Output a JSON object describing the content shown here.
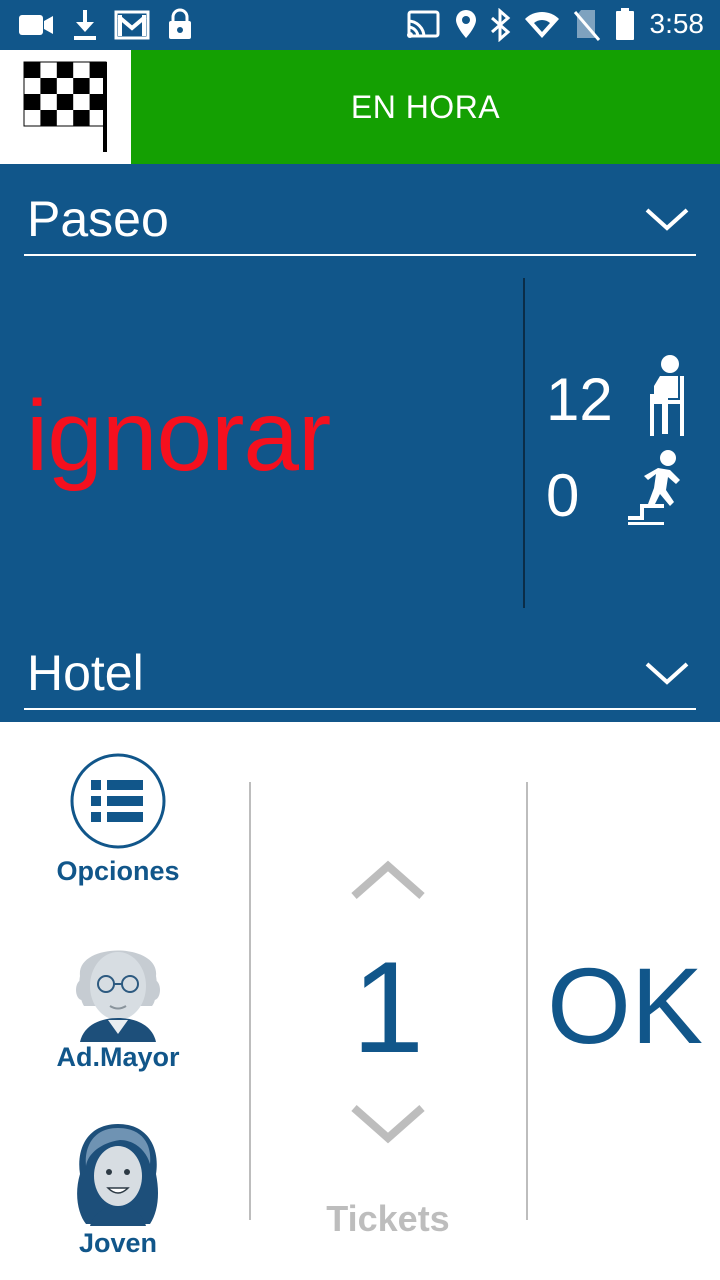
{
  "status_bar": {
    "time": "3:58",
    "icons": [
      "video-camera-icon",
      "download-icon",
      "gmail-icon",
      "lock-icon",
      "cast-icon",
      "location-pin-icon",
      "bluetooth-icon",
      "wifi-icon",
      "no-sim-icon",
      "battery-icon"
    ]
  },
  "header": {
    "status_label": "EN HORA",
    "status_color": "#14a002",
    "flag_icon": "checkered-flag-icon"
  },
  "trip": {
    "origin": "Paseo",
    "destination": "Hotel",
    "message": "ignorar",
    "message_color": "#f5101e",
    "seated_count": "12",
    "standing_count": "0",
    "panel_color": "#11568a"
  },
  "ticket_panel": {
    "options_label": "Opciones",
    "senior_label": "Ad.Mayor",
    "young_label": "Joven",
    "ticket_count": "1",
    "tickets_label": "Tickets",
    "ok_label": "OK",
    "accent_color": "#11568a"
  }
}
